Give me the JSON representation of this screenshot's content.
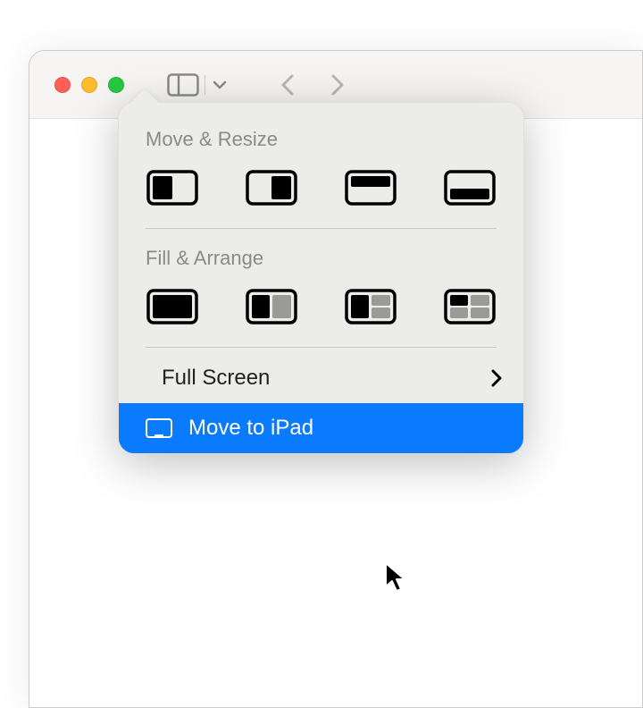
{
  "menu": {
    "section1_label": "Move & Resize",
    "section2_label": "Fill & Arrange",
    "full_screen_label": "Full Screen",
    "move_to_ipad_label": "Move to iPad"
  },
  "icons": {
    "move_left": "window-left-half-icon",
    "move_right": "window-right-half-icon",
    "move_top": "window-top-half-icon",
    "move_bottom": "window-bottom-half-icon",
    "fill_full": "window-fill-icon",
    "fill_2col_left": "window-two-col-left-icon",
    "fill_2col_right": "window-two-col-right-icon",
    "fill_4grid": "window-four-grid-icon"
  }
}
